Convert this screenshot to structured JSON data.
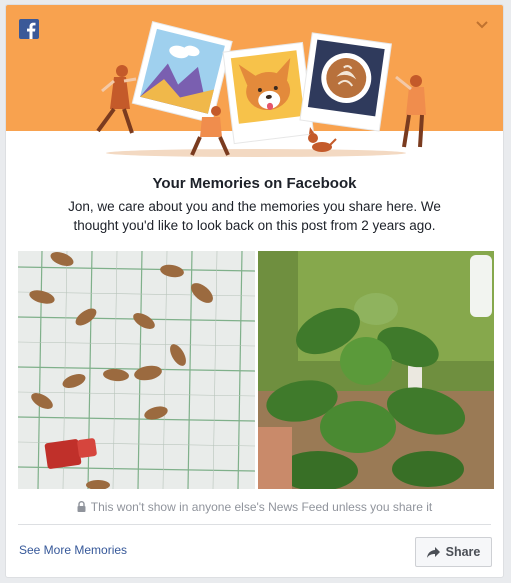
{
  "header": {
    "brand_icon": "facebook-icon",
    "menu_icon": "chevron-down-icon"
  },
  "memory": {
    "title": "Your Memories on Facebook",
    "message": "Jon, we care about you and the memories you share here. We thought you'd like to look back on this post from 2 years ago."
  },
  "photos": [
    {
      "description_icon": "photo-moths-on-grid"
    },
    {
      "description_icon": "photo-green-plant"
    }
  ],
  "privacy": {
    "icon": "lock-icon",
    "text": "This won't show in anyone else's News Feed unless you share it"
  },
  "footer": {
    "see_more_label": "See More Memories",
    "share_label": "Share",
    "share_icon": "share-arrow-icon"
  },
  "colors": {
    "banner": "#f8a24f",
    "facebook_blue": "#3b5998",
    "link": "#365899",
    "text": "#1d2129",
    "muted": "#90949c"
  }
}
